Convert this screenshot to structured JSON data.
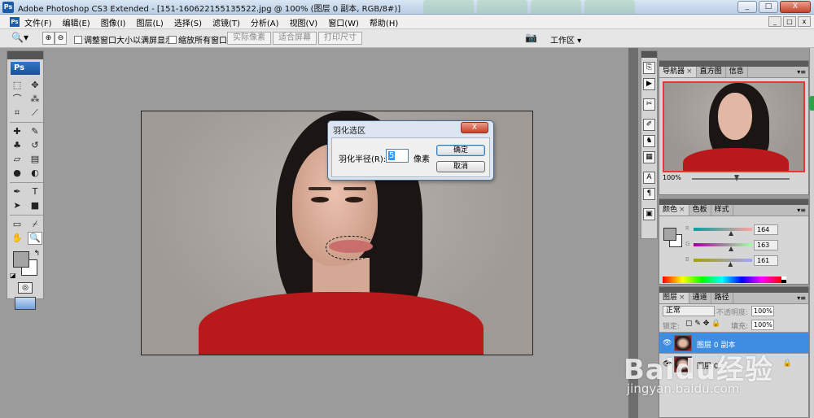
{
  "window": {
    "title": "Adobe Photoshop CS3 Extended - [151-160622155135522.jpg @ 100% (图层 0 副本, RGB/8#)]",
    "buttons": [
      "_",
      "□",
      "X"
    ]
  },
  "menu": {
    "items": [
      "文件(F)",
      "编辑(E)",
      "图像(I)",
      "图层(L)",
      "选择(S)",
      "滤镜(T)",
      "分析(A)",
      "视图(V)",
      "窗口(W)",
      "帮助(H)"
    ],
    "doc_buttons": [
      "_",
      "□",
      "x"
    ]
  },
  "options": {
    "resize_windows": "调整窗口大小以满屏显示",
    "zoom_all_windows": "缩放所有窗口",
    "actual_pixels": "实际像素",
    "fit_screen": "适合屏幕",
    "print_size": "打印尺寸",
    "workspace": "工作区 ▾"
  },
  "toolbox": {
    "logo": "Ps",
    "tools": [
      {
        "icon": "marquee-icon",
        "glyph": "⬚"
      },
      {
        "icon": "move-icon",
        "glyph": "✥"
      },
      {
        "icon": "lasso-icon",
        "glyph": "⌒"
      },
      {
        "icon": "magic-wand-icon",
        "glyph": "⁂"
      },
      {
        "icon": "crop-icon",
        "glyph": "⌗"
      },
      {
        "icon": "slice-icon",
        "glyph": "⟋"
      },
      {
        "icon": "healing-icon",
        "glyph": "✚"
      },
      {
        "icon": "brush-icon",
        "glyph": "✎"
      },
      {
        "icon": "stamp-icon",
        "glyph": "♣"
      },
      {
        "icon": "history-brush-icon",
        "glyph": "↺"
      },
      {
        "icon": "eraser-icon",
        "glyph": "▱"
      },
      {
        "icon": "gradient-icon",
        "glyph": "▤"
      },
      {
        "icon": "blur-icon",
        "glyph": "●"
      },
      {
        "icon": "dodge-icon",
        "glyph": "◐"
      },
      {
        "icon": "pen-icon",
        "glyph": "✒"
      },
      {
        "icon": "type-icon",
        "glyph": "T"
      },
      {
        "icon": "path-select-icon",
        "glyph": "➤"
      },
      {
        "icon": "shape-icon",
        "glyph": "■"
      },
      {
        "icon": "notes-icon",
        "glyph": "▭"
      },
      {
        "icon": "eyedropper-icon",
        "glyph": "⌿"
      },
      {
        "icon": "hand-icon",
        "glyph": "✋"
      },
      {
        "icon": "zoom-icon",
        "glyph": "🔍"
      }
    ]
  },
  "dialog": {
    "title": "羽化选区",
    "close": "X",
    "label": "羽化半径(R):",
    "value": "5",
    "unit": "像素",
    "ok": "确定",
    "cancel": "取消"
  },
  "navigator": {
    "tabs": [
      "导航器",
      "直方图",
      "信息"
    ],
    "zoom": "100%"
  },
  "color": {
    "tabs": [
      "颜色",
      "色板",
      "样式"
    ],
    "channels": [
      {
        "label": "R",
        "value": "164",
        "fraction": 0.64
      },
      {
        "label": "G",
        "value": "163",
        "fraction": 0.64
      },
      {
        "label": "B",
        "value": "161",
        "fraction": 0.63
      }
    ]
  },
  "layers": {
    "tabs": [
      "图层",
      "通道",
      "路径"
    ],
    "blend_mode": "正常",
    "opacity_label": "不透明度:",
    "opacity": "100%",
    "lock_label": "锁定:",
    "fill_label": "填充:",
    "fill": "100%",
    "items": [
      {
        "name": "图层 0 副本",
        "selected": true
      },
      {
        "name": "图层 0",
        "selected": false
      }
    ]
  },
  "watermark": {
    "logo": "Baidu经验",
    "url": "jingyan.baidu.com"
  }
}
